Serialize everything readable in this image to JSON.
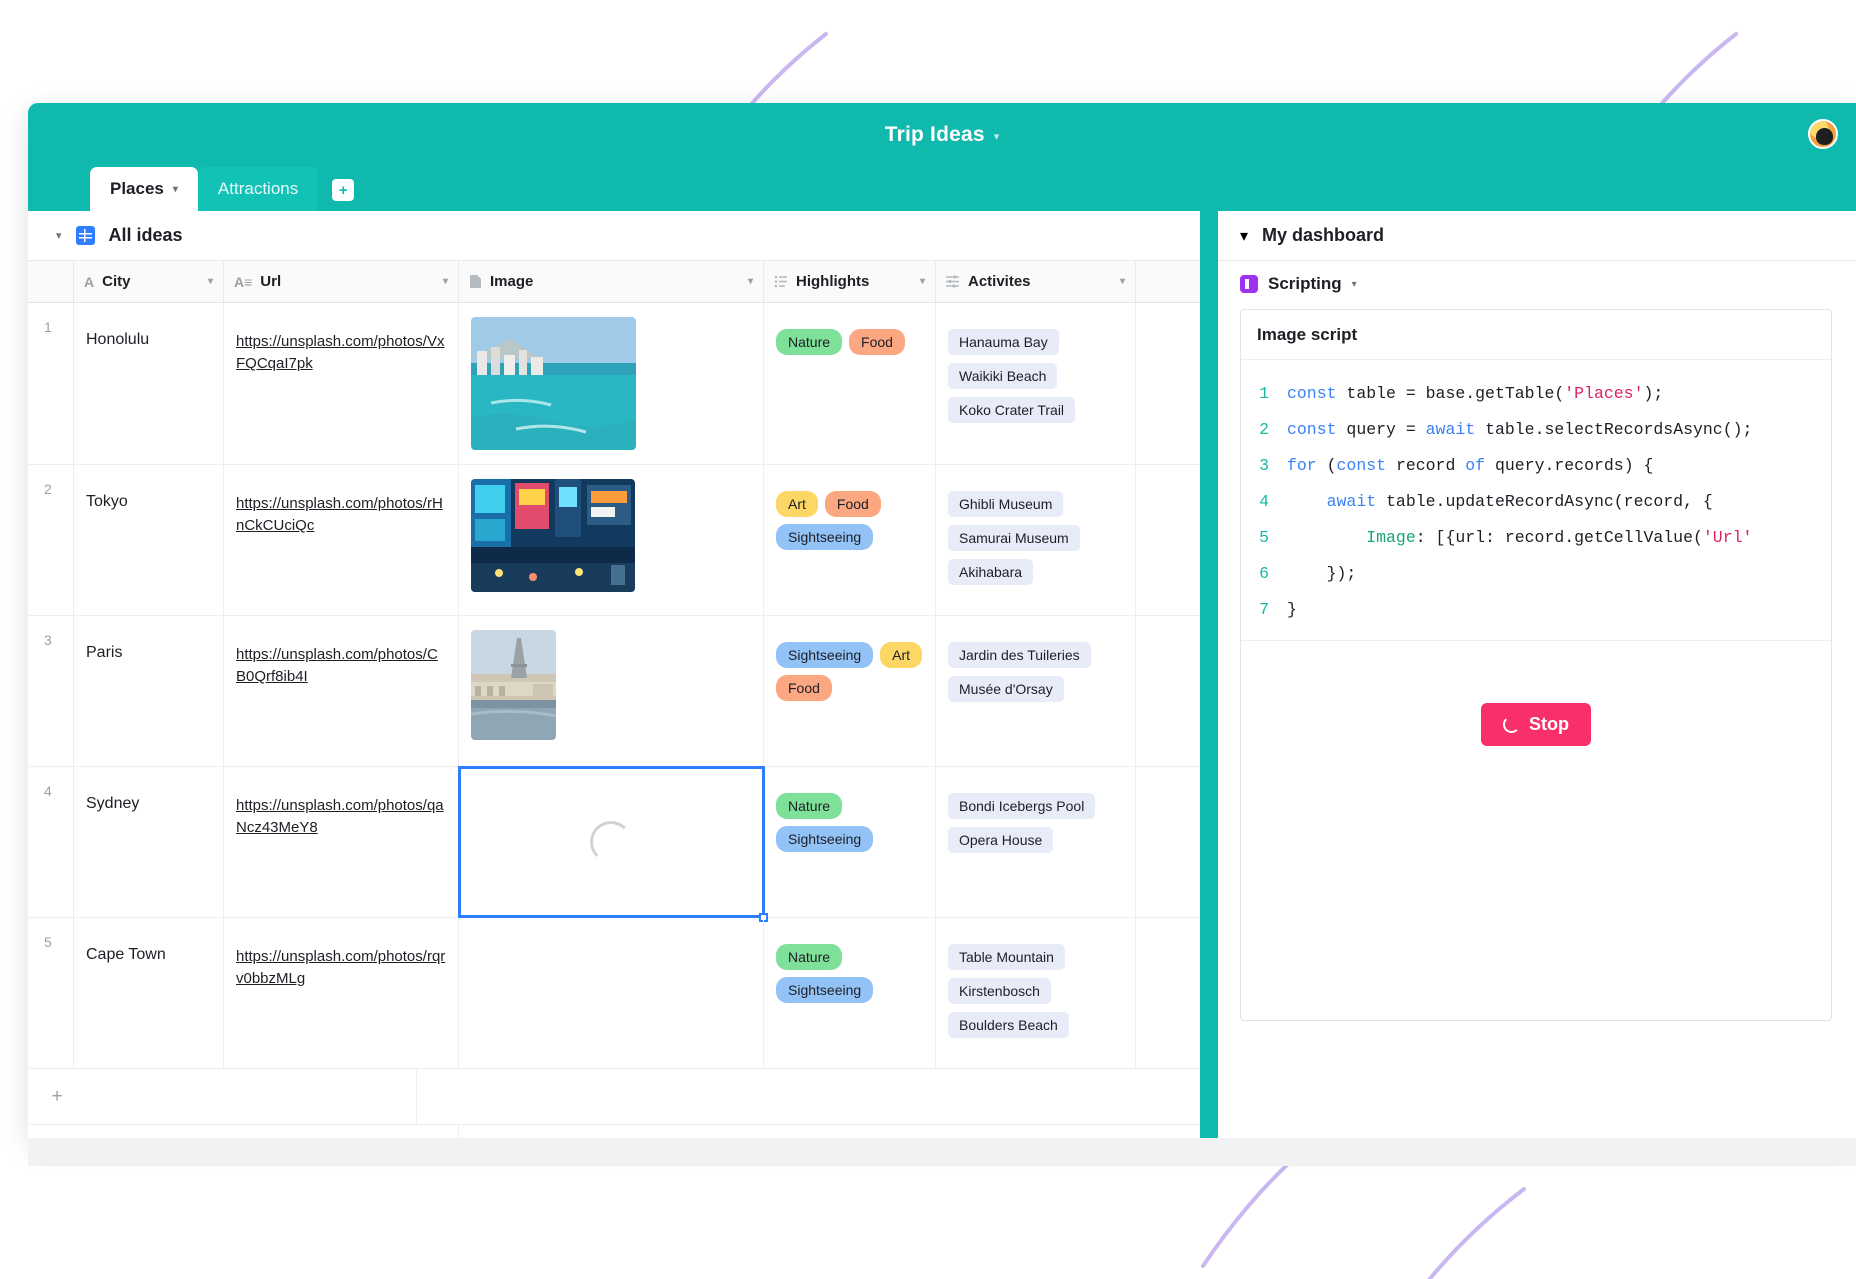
{
  "window": {
    "title": "Trip Ideas",
    "title_caret": "▾",
    "avatar_name": "user-avatar"
  },
  "tabs": [
    {
      "label": "Places",
      "active": true,
      "caret": "▾"
    },
    {
      "label": "Attractions",
      "active": false,
      "caret": ""
    }
  ],
  "add_tab_label": "+",
  "view": {
    "caret": "▾",
    "name": "All ideas"
  },
  "grid": {
    "columns": [
      {
        "key": "num",
        "label": "",
        "icon": "",
        "caret": ""
      },
      {
        "key": "city",
        "label": "City",
        "icon": "A",
        "caret": "▾"
      },
      {
        "key": "url",
        "label": "Url",
        "icon": "A≡",
        "caret": "▾"
      },
      {
        "key": "image",
        "label": "Image",
        "icon": "file-icon",
        "caret": "▾"
      },
      {
        "key": "highlights",
        "label": "Highlights",
        "icon": "list-icon",
        "caret": "▾"
      },
      {
        "key": "activities",
        "label": "Activites",
        "icon": "sliders-icon",
        "caret": "▾"
      }
    ],
    "rows": [
      {
        "num": "1",
        "city": "Honolulu",
        "url": "https://unsplash.com/photos/VxFQCqaI7pk",
        "image": "honolulu-beach-thumbnail",
        "highlights": [
          {
            "label": "Nature",
            "color": "#7fe09a"
          },
          {
            "label": "Food",
            "color": "#fba882"
          }
        ],
        "activities": [
          "Hanauma Bay",
          "Waikiki Beach",
          "Koko Crater Trail"
        ]
      },
      {
        "num": "2",
        "city": "Tokyo",
        "url": "https://unsplash.com/photos/rHnCkCUciQc",
        "image": "tokyo-street-thumbnail",
        "highlights": [
          {
            "label": "Art",
            "color": "#fcd766"
          },
          {
            "label": "Food",
            "color": "#fba882"
          },
          {
            "label": "Sightseeing",
            "color": "#93c2f7"
          }
        ],
        "activities": [
          "Ghibli Museum",
          "Samurai Museum",
          "Akihabara"
        ]
      },
      {
        "num": "3",
        "city": "Paris",
        "url": "https://unsplash.com/photos/CB0Qrf8ib4I",
        "image": "paris-skyline-thumbnail",
        "highlights": [
          {
            "label": "Sightseeing",
            "color": "#93c2f7"
          },
          {
            "label": "Art",
            "color": "#fcd766"
          },
          {
            "label": "Food",
            "color": "#fba882"
          }
        ],
        "activities": [
          "Jardin des Tuileries",
          "Musée d'Orsay"
        ]
      },
      {
        "num": "4",
        "city": "Sydney",
        "url": "https://unsplash.com/photos/qaNcz43MeY8",
        "image": "loading-spinner",
        "selected": true,
        "highlights": [
          {
            "label": "Nature",
            "color": "#7fe09a"
          },
          {
            "label": "Sightseeing",
            "color": "#93c2f7"
          }
        ],
        "activities": [
          "Bondi Icebergs Pool",
          "Opera House"
        ]
      },
      {
        "num": "5",
        "city": "Cape Town",
        "url": "https://unsplash.com/photos/rqrv0bbzMLg",
        "image": "",
        "highlights": [
          {
            "label": "Nature",
            "color": "#7fe09a"
          },
          {
            "label": "Sightseeing",
            "color": "#93c2f7"
          }
        ],
        "activities": [
          "Table Mountain",
          "Kirstenbosch",
          "Boulders Beach"
        ]
      }
    ],
    "add_record_label": "+"
  },
  "dashboard": {
    "caret": "▾",
    "name": "My dashboard",
    "app": {
      "label": "Scripting",
      "caret": "▾",
      "icon": "scripting-icon"
    },
    "script_title": "Image script",
    "code_lines": [
      {
        "n": "1",
        "tokens": [
          {
            "t": "const ",
            "c": "kw"
          },
          {
            "t": "table = base.getTable(",
            "c": ""
          },
          {
            "t": "'Places'",
            "c": "str"
          },
          {
            "t": ");",
            "c": ""
          }
        ]
      },
      {
        "n": "2",
        "tokens": [
          {
            "t": "const ",
            "c": "kw"
          },
          {
            "t": "query = ",
            "c": ""
          },
          {
            "t": "await ",
            "c": "kw"
          },
          {
            "t": "table.selectRecordsAsync();",
            "c": ""
          }
        ]
      },
      {
        "n": "3",
        "tokens": [
          {
            "t": "for ",
            "c": "kw"
          },
          {
            "t": "(",
            "c": ""
          },
          {
            "t": "const ",
            "c": "kw"
          },
          {
            "t": "record ",
            "c": ""
          },
          {
            "t": "of ",
            "c": "kw"
          },
          {
            "t": "query.records) {",
            "c": ""
          }
        ]
      },
      {
        "n": "4",
        "tokens": [
          {
            "t": "    ",
            "c": ""
          },
          {
            "t": "await ",
            "c": "kw"
          },
          {
            "t": "table.updateRecordAsync(record, {",
            "c": ""
          }
        ]
      },
      {
        "n": "5",
        "tokens": [
          {
            "t": "        ",
            "c": ""
          },
          {
            "t": "Image",
            "c": "prop"
          },
          {
            "t": ": [{url: record.getCellValue(",
            "c": ""
          },
          {
            "t": "'Url'",
            "c": "str"
          }
        ]
      },
      {
        "n": "6",
        "tokens": [
          {
            "t": "    });",
            "c": ""
          }
        ]
      },
      {
        "n": "7",
        "tokens": [
          {
            "t": "}",
            "c": ""
          }
        ]
      }
    ],
    "stop_button": "Stop"
  },
  "colors": {
    "brand_teal": "#0fb9ae",
    "accent_blue": "#2f7eff",
    "stop_pink": "#f92f6a",
    "script_purple": "#a12fef"
  }
}
